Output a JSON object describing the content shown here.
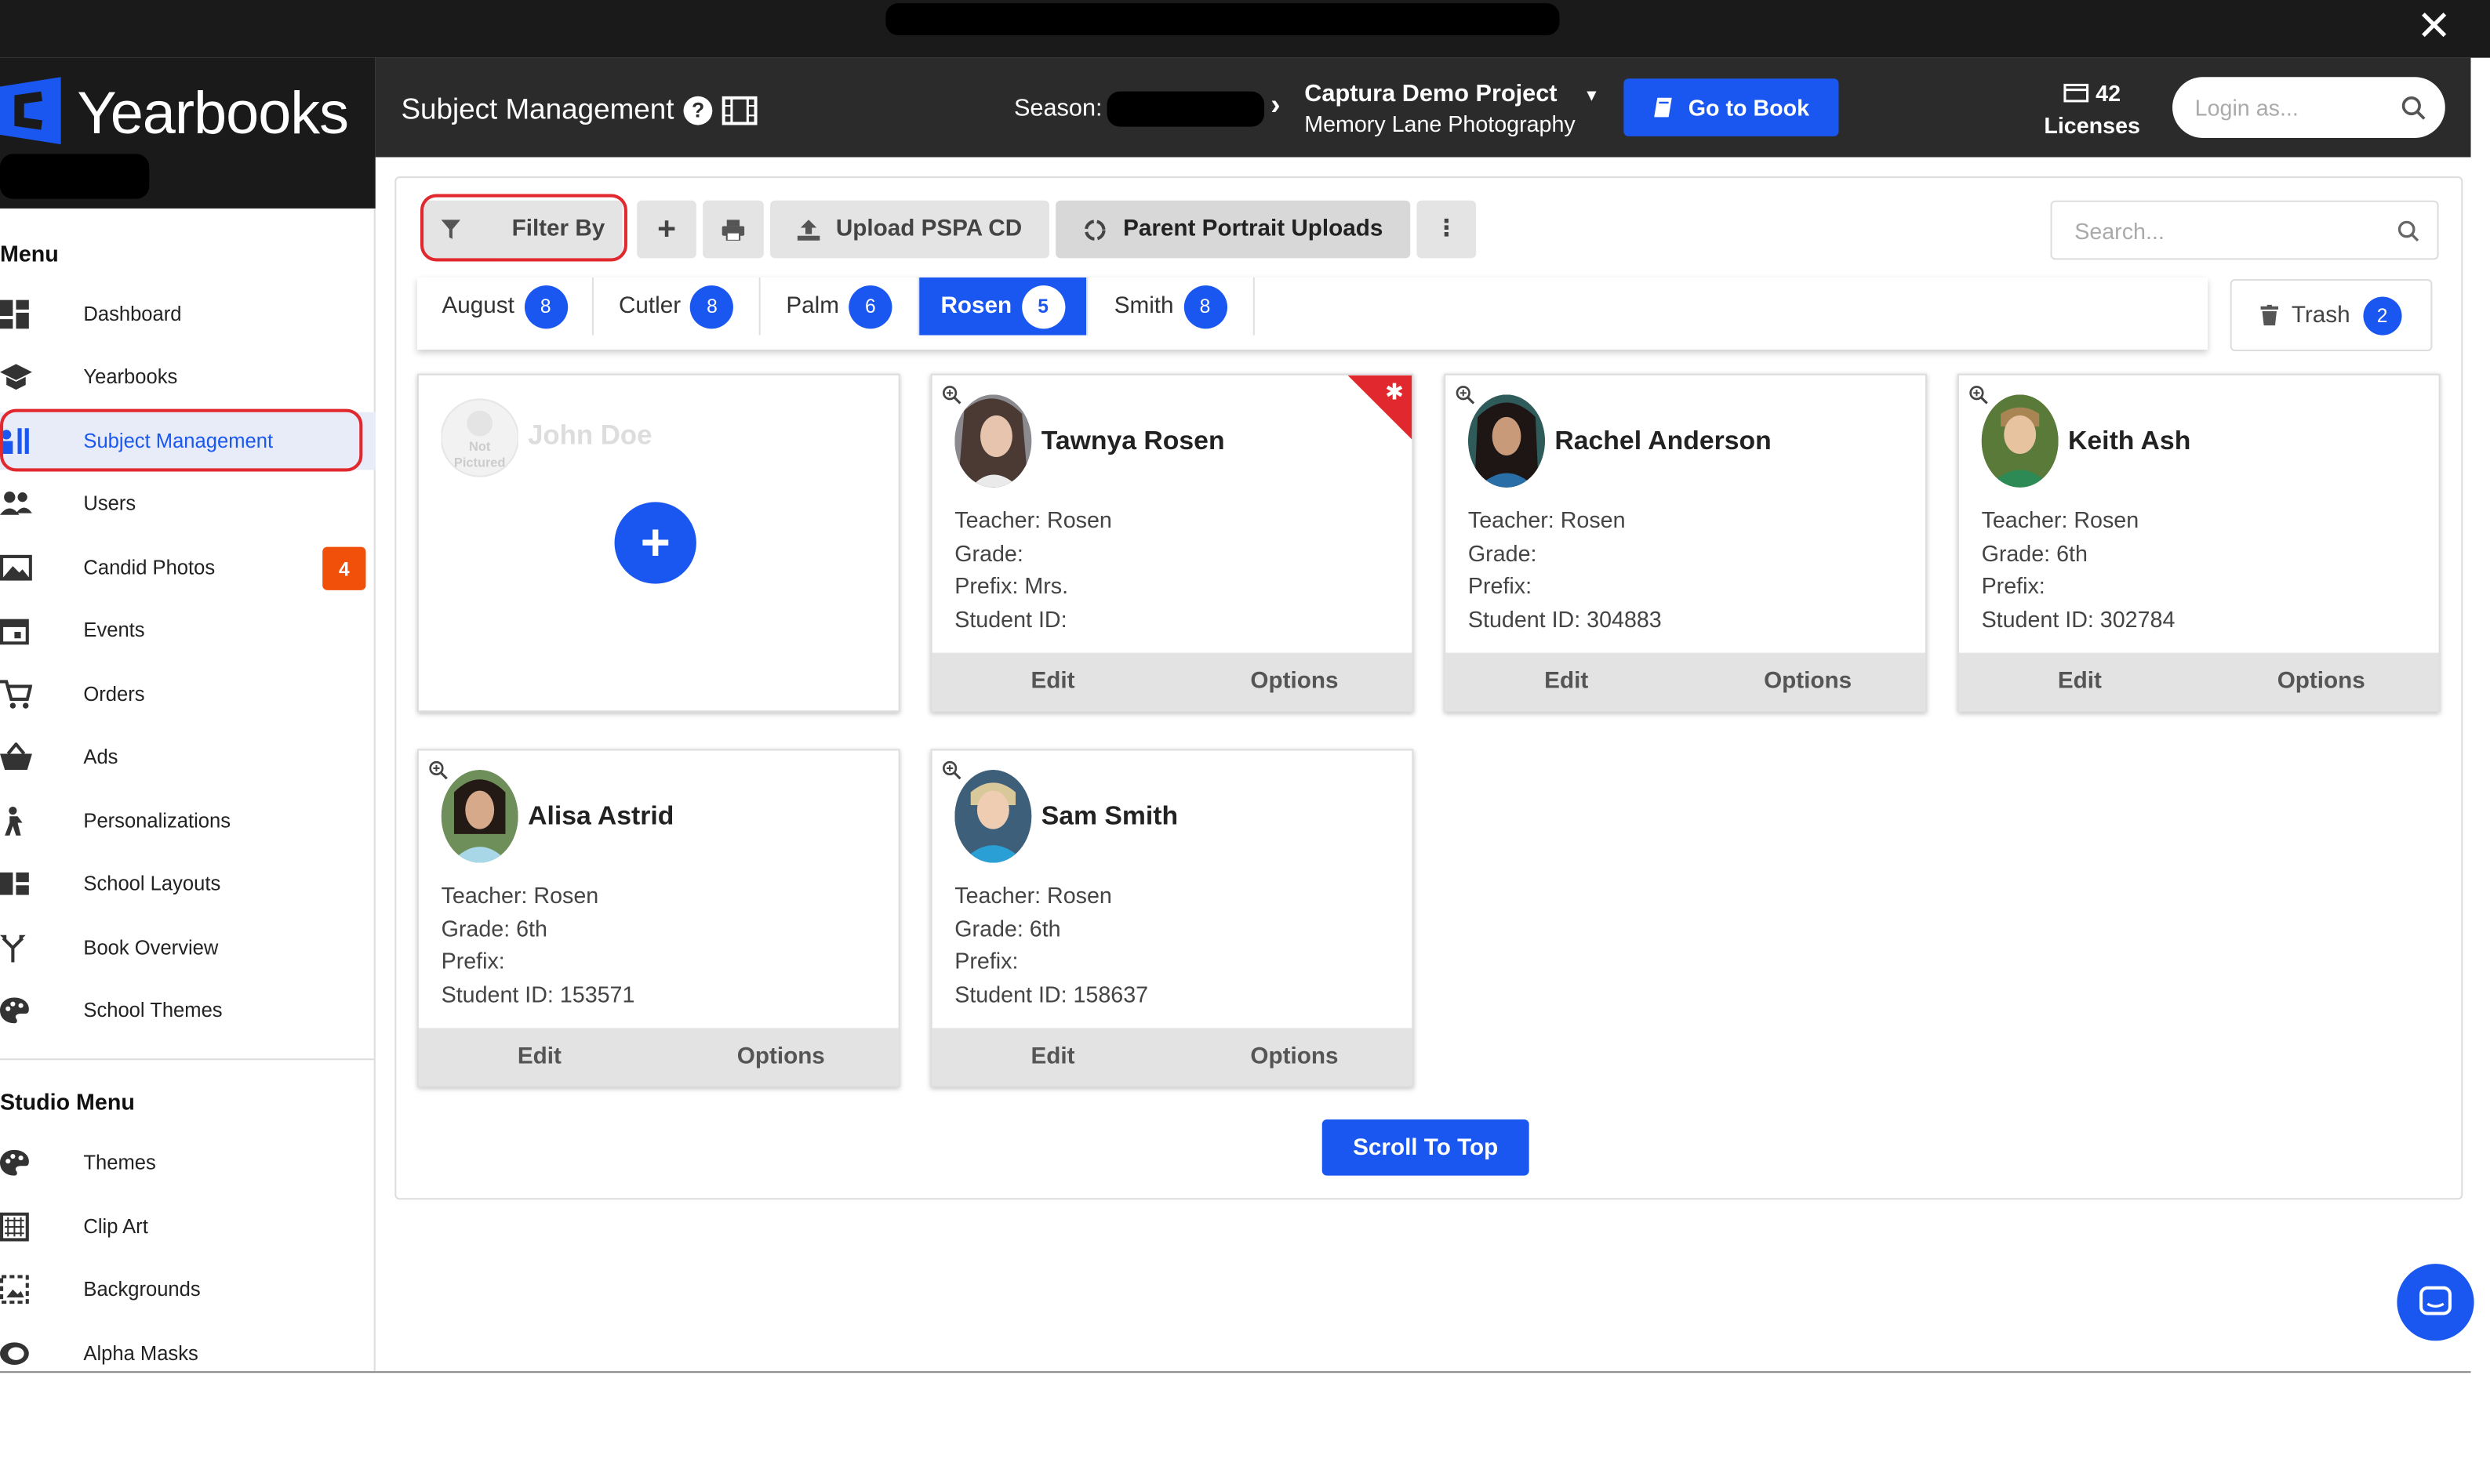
{
  "window": {
    "close_glyph": "✕"
  },
  "brand": {
    "name": "Yearbooks",
    "color": "#1a57f0"
  },
  "header": {
    "title": "Subject Management",
    "help_glyph": "?",
    "season_label": "Season:",
    "project_name": "Captura Demo Project",
    "studio_name": "Memory Lane Photography",
    "caret": "▾",
    "go_to_book": "Go to Book",
    "licenses_count": "42",
    "licenses_label": "Licenses",
    "login_placeholder": "Login as..."
  },
  "sidebar": {
    "menu_heading": "Menu",
    "items": [
      {
        "label": "Dashboard",
        "icon": "dashboard-icon"
      },
      {
        "label": "Yearbooks",
        "icon": "graduation-cap-icon"
      },
      {
        "label": "Subject Management",
        "icon": "subject-management-icon",
        "active": true
      },
      {
        "label": "Users",
        "icon": "users-icon"
      },
      {
        "label": "Candid Photos",
        "icon": "image-icon",
        "badge": "4"
      },
      {
        "label": "Events",
        "icon": "calendar-icon"
      },
      {
        "label": "Orders",
        "icon": "cart-icon"
      },
      {
        "label": "Ads",
        "icon": "basket-icon"
      },
      {
        "label": "Personalizations",
        "icon": "person-icon"
      },
      {
        "label": "School Layouts",
        "icon": "layout-icon"
      },
      {
        "label": "Book Overview",
        "icon": "branch-icon"
      },
      {
        "label": "School Themes",
        "icon": "palette-icon"
      }
    ],
    "studio_heading": "Studio Menu",
    "studio_items": [
      {
        "label": "Themes",
        "icon": "palette-icon"
      },
      {
        "label": "Clip Art",
        "icon": "clipart-icon"
      },
      {
        "label": "Backgrounds",
        "icon": "background-icon"
      },
      {
        "label": "Alpha Masks",
        "icon": "mask-icon"
      }
    ]
  },
  "toolbar": {
    "filter_by": "Filter By",
    "add_glyph": "+",
    "upload_pspa": "Upload PSPA CD",
    "parent_uploads": "Parent Portrait Uploads",
    "more_glyph": "⋮",
    "search_placeholder": "Search..."
  },
  "tabs": [
    {
      "label": "August",
      "count": "8"
    },
    {
      "label": "Cutler",
      "count": "8"
    },
    {
      "label": "Palm",
      "count": "6"
    },
    {
      "label": "Rosen",
      "count": "5",
      "active": true
    },
    {
      "label": "Smith",
      "count": "8"
    }
  ],
  "trash": {
    "label": "Trash",
    "count": "2"
  },
  "new_subject": {
    "name": "John Doe",
    "not_pictured": "Not Pictured",
    "plus": "+"
  },
  "subjects": [
    {
      "name": "Tawnya Rosen",
      "teacher": "Teacher: Rosen",
      "grade": "Grade:",
      "prefix": "Prefix: Mrs.",
      "student_id": "Student ID:",
      "flagged": true,
      "flag_glyph": "✱"
    },
    {
      "name": "Rachel Anderson",
      "teacher": "Teacher: Rosen",
      "grade": "Grade:",
      "prefix": "Prefix:",
      "student_id": "Student ID: 304883"
    },
    {
      "name": "Keith Ash",
      "teacher": "Teacher: Rosen",
      "grade": "Grade: 6th",
      "prefix": "Prefix:",
      "student_id": "Student ID: 302784"
    },
    {
      "name": "Alisa Astrid",
      "teacher": "Teacher: Rosen",
      "grade": "Grade: 6th",
      "prefix": "Prefix:",
      "student_id": "Student ID: 153571"
    },
    {
      "name": "Sam Smith",
      "teacher": "Teacher: Rosen",
      "grade": "Grade: 6th",
      "prefix": "Prefix:",
      "student_id": "Student ID: 158637"
    }
  ],
  "card_actions": {
    "edit": "Edit",
    "options": "Options"
  },
  "scroll_to_top": "Scroll To Top"
}
